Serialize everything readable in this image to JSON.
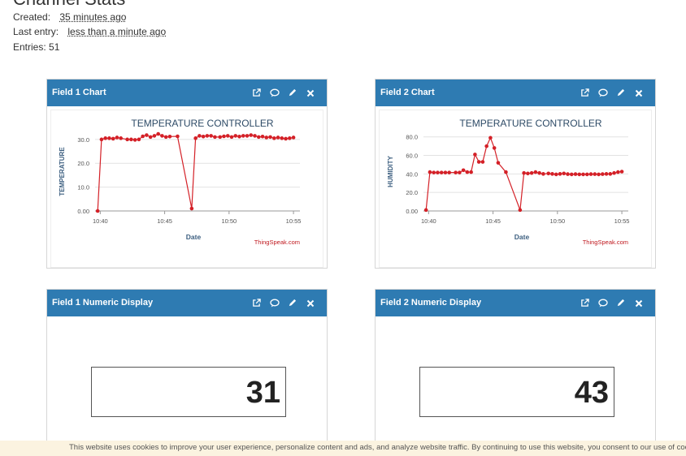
{
  "page": {
    "title": "Channel Stats",
    "created_label": "Created:",
    "created_value": "35 minutes ago",
    "last_entry_label": "Last entry:",
    "last_entry_value": "less than a minute ago",
    "entries": "Entries: 51"
  },
  "panels": {
    "field1_chart": {
      "title": "Field 1 Chart"
    },
    "field2_chart": {
      "title": "Field 2 Chart"
    },
    "field1_numeric": {
      "title": "Field 1 Numeric Display",
      "value": "31"
    },
    "field2_numeric": {
      "title": "Field 2 Numeric Display",
      "value": "43"
    }
  },
  "icons": [
    "external-link-icon",
    "comment-icon",
    "pencil-icon",
    "close-icon"
  ],
  "theme": {
    "header": "#2e7bb2",
    "line": "#d42027",
    "cookie_bg": "#fbf3e0"
  },
  "cookie": {
    "text": "This website uses cookies to improve your user experience, personalize content and ads, and analyze website traffic. By continuing to use this website, you consent to our use of cookies. Ple"
  },
  "chart_data": [
    {
      "type": "line",
      "title": "TEMPERATURE CONTROLLER",
      "xlabel": "Date",
      "ylabel": "TEMPERATURE",
      "credit": "ThingSpeak.com",
      "ylim": [
        0,
        33
      ],
      "yticks": [
        "0.00",
        "10.0",
        "20.0",
        "30.0"
      ],
      "ytick_values": [
        0,
        10,
        20,
        30
      ],
      "xlim": [
        39.6,
        55.5
      ],
      "xticks": [
        "10:40",
        "10:45",
        "10:50",
        "10:55"
      ],
      "xtick_values": [
        40,
        45,
        50,
        55
      ],
      "x_minutes": [
        39.8,
        40.1,
        40.4,
        40.7,
        41.0,
        41.3,
        41.6,
        42.1,
        42.4,
        42.7,
        43.0,
        43.3,
        43.6,
        43.9,
        44.2,
        44.5,
        44.8,
        45.1,
        45.4,
        46.0,
        47.1,
        47.4,
        47.7,
        48.0,
        48.3,
        48.6,
        48.9,
        49.3,
        49.6,
        49.9,
        50.2,
        50.5,
        50.8,
        51.1,
        51.4,
        51.7,
        52.0,
        52.3,
        52.6,
        52.9,
        53.2,
        53.5,
        53.8,
        54.1,
        54.4,
        54.7,
        55.0
      ],
      "values": [
        0,
        30,
        30.5,
        30.5,
        30.3,
        30.8,
        30.5,
        30,
        30,
        29.8,
        30,
        31.3,
        31.8,
        31,
        31.5,
        32.3,
        31.5,
        31,
        31.2,
        31.3,
        1,
        30.5,
        31.5,
        31.2,
        31.5,
        31.5,
        31,
        31,
        31.3,
        31.5,
        31,
        31.5,
        31.2,
        31.5,
        31.5,
        31.8,
        31.5,
        31,
        31.2,
        30.8,
        31,
        30.5,
        30.8,
        30.5,
        30.3,
        30.5,
        30.8
      ]
    },
    {
      "type": "line",
      "title": "TEMPERATURE CONTROLLER",
      "xlabel": "Date",
      "ylabel": "HUMIDITY",
      "credit": "ThingSpeak.com",
      "ylim": [
        0,
        85
      ],
      "yticks": [
        "0.00",
        "20.0",
        "40.0",
        "60.0",
        "80.0"
      ],
      "ytick_values": [
        0,
        20,
        40,
        60,
        80
      ],
      "xlim": [
        39.6,
        55.5
      ],
      "xticks": [
        "10:40",
        "10:45",
        "10:50",
        "10:55"
      ],
      "xtick_values": [
        40,
        45,
        50,
        55
      ],
      "x_minutes": [
        39.8,
        40.1,
        40.4,
        40.7,
        41.0,
        41.3,
        41.6,
        42.1,
        42.4,
        42.7,
        43.0,
        43.3,
        43.6,
        43.9,
        44.2,
        44.5,
        44.8,
        45.1,
        45.4,
        46.0,
        47.1,
        47.4,
        47.7,
        48.0,
        48.3,
        48.6,
        48.9,
        49.3,
        49.6,
        49.9,
        50.2,
        50.5,
        50.8,
        51.1,
        51.4,
        51.7,
        52.0,
        52.3,
        52.6,
        52.9,
        53.2,
        53.5,
        53.8,
        54.1,
        54.4,
        54.7,
        55.0
      ],
      "values": [
        1,
        42,
        41.5,
        41.5,
        41.5,
        41.5,
        41.5,
        41.5,
        41.5,
        44,
        42,
        42,
        61,
        53,
        53,
        70,
        79,
        68,
        52,
        42,
        1,
        41,
        40.5,
        41,
        42,
        41,
        40,
        40.5,
        40,
        39.5,
        40,
        40.5,
        39.8,
        39.5,
        39.8,
        39.5,
        39.5,
        39.5,
        39.8,
        39.8,
        39.5,
        39.8,
        40,
        40,
        41,
        42,
        42.5
      ]
    }
  ]
}
